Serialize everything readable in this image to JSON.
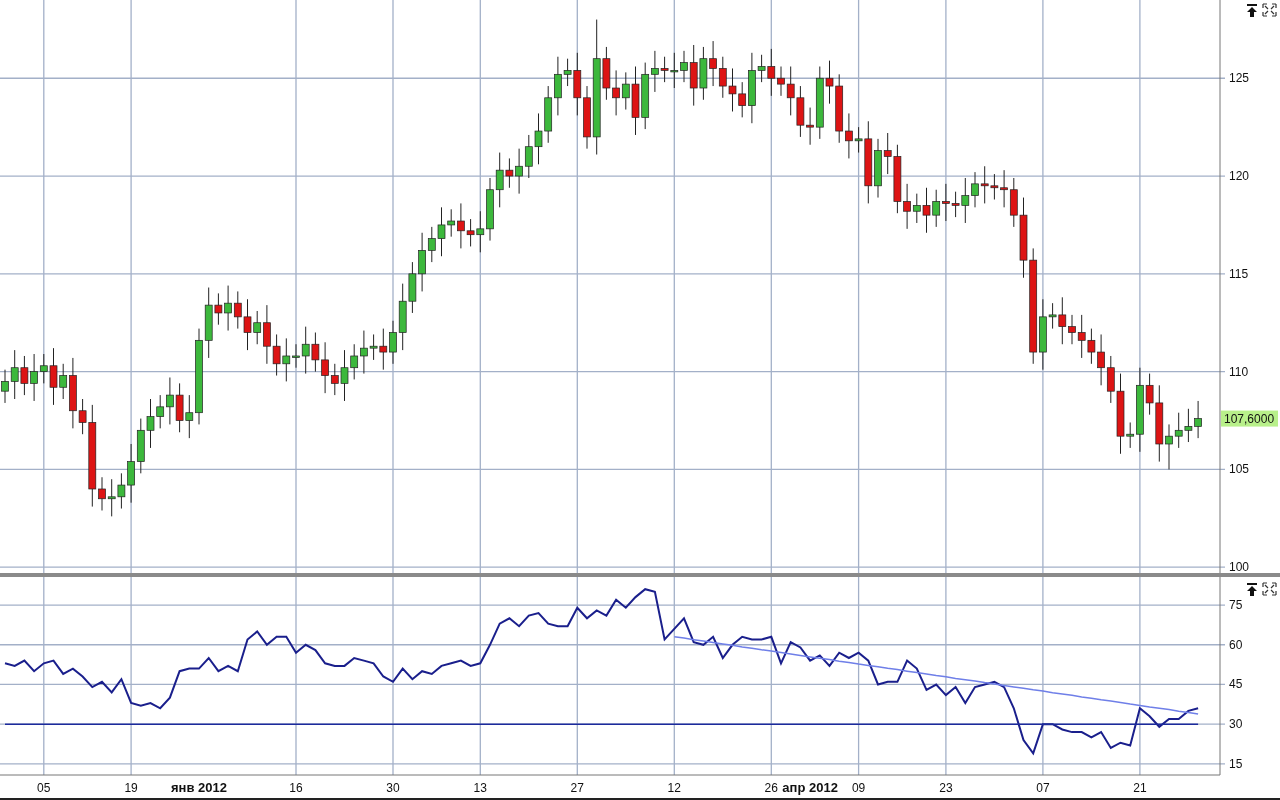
{
  "price_panel": {
    "last_price_tag": "107,6000",
    "chart_data": {
      "type": "candlestick",
      "grid": true,
      "ylim": [
        99.5,
        129
      ],
      "yticks": [
        100,
        105,
        110,
        115,
        120,
        125
      ],
      "ohlc": [
        [
          109.0,
          110.1,
          108.4,
          109.5
        ],
        [
          109.5,
          111.1,
          108.6,
          110.2
        ],
        [
          110.2,
          110.8,
          108.8,
          109.4
        ],
        [
          109.4,
          110.9,
          108.5,
          110.0
        ],
        [
          110.0,
          110.9,
          109.4,
          110.3
        ],
        [
          110.3,
          111.2,
          108.3,
          109.2
        ],
        [
          109.2,
          110.4,
          108.6,
          109.8
        ],
        [
          109.8,
          110.7,
          107.1,
          108.0
        ],
        [
          108.0,
          108.6,
          106.8,
          107.4
        ],
        [
          107.4,
          108.3,
          103.1,
          104.0
        ],
        [
          104.0,
          104.6,
          102.9,
          103.5
        ],
        [
          103.5,
          104.5,
          102.6,
          103.6
        ],
        [
          103.6,
          104.8,
          103.0,
          104.2
        ],
        [
          104.2,
          106.3,
          103.3,
          105.4
        ],
        [
          105.4,
          107.6,
          104.8,
          107.0
        ],
        [
          107.0,
          108.6,
          106.1,
          107.7
        ],
        [
          107.7,
          108.8,
          107.1,
          108.2
        ],
        [
          108.2,
          109.7,
          107.3,
          108.8
        ],
        [
          108.8,
          109.4,
          106.9,
          107.5
        ],
        [
          107.5,
          108.8,
          106.6,
          107.9
        ],
        [
          107.9,
          112.2,
          107.3,
          111.6
        ],
        [
          111.6,
          114.3,
          110.7,
          113.4
        ],
        [
          113.4,
          114.0,
          112.4,
          113.0
        ],
        [
          113.0,
          114.4,
          112.1,
          113.5
        ],
        [
          113.5,
          114.1,
          112.2,
          112.8
        ],
        [
          112.8,
          113.7,
          111.1,
          112.0
        ],
        [
          112.0,
          113.1,
          111.4,
          112.5
        ],
        [
          112.5,
          113.4,
          110.4,
          111.3
        ],
        [
          111.3,
          111.9,
          109.8,
          110.4
        ],
        [
          110.4,
          111.7,
          109.5,
          110.8
        ],
        [
          110.8,
          111.4,
          110.2,
          110.8
        ],
        [
          110.8,
          112.3,
          109.9,
          111.4
        ],
        [
          111.4,
          112.0,
          110.0,
          110.6
        ],
        [
          110.6,
          111.5,
          108.9,
          109.8
        ],
        [
          109.8,
          110.4,
          108.8,
          109.4
        ],
        [
          109.4,
          111.1,
          108.5,
          110.2
        ],
        [
          110.2,
          111.4,
          109.6,
          110.8
        ],
        [
          110.8,
          112.1,
          109.9,
          111.2
        ],
        [
          111.2,
          111.9,
          110.6,
          111.3
        ],
        [
          111.3,
          112.2,
          110.1,
          111.0
        ],
        [
          111.0,
          112.6,
          110.4,
          112.0
        ],
        [
          112.0,
          114.5,
          111.1,
          113.6
        ],
        [
          113.6,
          115.6,
          113.0,
          115.0
        ],
        [
          115.0,
          117.1,
          114.1,
          116.2
        ],
        [
          116.2,
          117.4,
          115.6,
          116.8
        ],
        [
          116.8,
          118.4,
          115.9,
          117.5
        ],
        [
          117.5,
          118.3,
          116.9,
          117.7
        ],
        [
          117.7,
          118.6,
          116.3,
          117.2
        ],
        [
          117.2,
          117.8,
          116.4,
          117.0
        ],
        [
          117.0,
          118.2,
          116.1,
          117.3
        ],
        [
          117.3,
          119.9,
          116.7,
          119.3
        ],
        [
          119.3,
          121.2,
          118.4,
          120.3
        ],
        [
          120.3,
          120.9,
          119.4,
          120.0
        ],
        [
          120.0,
          121.4,
          119.1,
          120.5
        ],
        [
          120.5,
          122.1,
          119.9,
          121.5
        ],
        [
          121.5,
          123.2,
          120.6,
          122.3
        ],
        [
          122.3,
          124.6,
          121.7,
          124.0
        ],
        [
          124.0,
          126.1,
          123.1,
          125.2
        ],
        [
          125.2,
          126.0,
          124.6,
          125.4
        ],
        [
          125.4,
          126.3,
          123.1,
          124.0
        ],
        [
          124.0,
          124.6,
          121.4,
          122.0
        ],
        [
          122.0,
          128.0,
          121.1,
          126.0
        ],
        [
          126.0,
          126.6,
          123.9,
          124.5
        ],
        [
          124.5,
          125.4,
          123.1,
          124.0
        ],
        [
          124.0,
          125.3,
          123.4,
          124.7
        ],
        [
          124.7,
          125.6,
          122.1,
          123.0
        ],
        [
          123.0,
          125.8,
          122.4,
          125.2
        ],
        [
          125.2,
          126.4,
          124.3,
          125.5
        ],
        [
          125.5,
          126.1,
          124.8,
          125.4
        ],
        [
          125.4,
          126.3,
          124.5,
          125.4
        ],
        [
          125.4,
          126.4,
          124.8,
          125.8
        ],
        [
          125.8,
          126.7,
          123.6,
          124.5
        ],
        [
          124.5,
          126.6,
          123.9,
          126.0
        ],
        [
          126.0,
          126.9,
          124.6,
          125.5
        ],
        [
          125.5,
          126.1,
          124.0,
          124.6
        ],
        [
          124.6,
          125.5,
          123.3,
          124.2
        ],
        [
          124.2,
          124.8,
          123.0,
          123.6
        ],
        [
          123.6,
          126.3,
          122.7,
          125.4
        ],
        [
          125.4,
          126.2,
          124.8,
          125.6
        ],
        [
          125.6,
          126.5,
          124.1,
          125.0
        ],
        [
          125.0,
          125.6,
          124.1,
          124.7
        ],
        [
          124.7,
          125.6,
          123.1,
          124.0
        ],
        [
          124.0,
          124.6,
          122.0,
          122.6
        ],
        [
          122.6,
          123.5,
          121.6,
          122.5
        ],
        [
          122.5,
          125.6,
          121.9,
          125.0
        ],
        [
          125.0,
          125.9,
          123.7,
          124.6
        ],
        [
          124.6,
          125.2,
          121.7,
          122.3
        ],
        [
          122.3,
          123.2,
          120.9,
          121.8
        ],
        [
          121.8,
          122.5,
          121.2,
          121.9
        ],
        [
          121.9,
          122.8,
          118.6,
          119.5
        ],
        [
          119.5,
          121.9,
          118.9,
          121.3
        ],
        [
          121.3,
          122.2,
          120.1,
          121.0
        ],
        [
          121.0,
          121.6,
          118.1,
          118.7
        ],
        [
          118.7,
          119.6,
          117.3,
          118.2
        ],
        [
          118.2,
          119.1,
          117.6,
          118.5
        ],
        [
          118.5,
          119.4,
          117.1,
          118.0
        ],
        [
          118.0,
          119.3,
          117.4,
          118.7
        ],
        [
          118.7,
          119.6,
          117.7,
          118.6
        ],
        [
          118.6,
          119.2,
          117.9,
          118.5
        ],
        [
          118.5,
          119.9,
          117.6,
          119.0
        ],
        [
          119.0,
          120.2,
          118.4,
          119.6
        ],
        [
          119.6,
          120.5,
          118.6,
          119.5
        ],
        [
          119.5,
          120.1,
          118.8,
          119.4
        ],
        [
          119.4,
          120.3,
          118.4,
          119.3
        ],
        [
          119.3,
          119.9,
          117.4,
          118.0
        ],
        [
          118.0,
          118.9,
          114.8,
          115.7
        ],
        [
          115.7,
          116.3,
          110.4,
          111.0
        ],
        [
          111.0,
          113.7,
          110.1,
          112.8
        ],
        [
          112.8,
          113.5,
          112.2,
          112.9
        ],
        [
          112.9,
          113.8,
          111.4,
          112.3
        ],
        [
          112.3,
          112.9,
          111.4,
          112.0
        ],
        [
          112.0,
          112.9,
          110.7,
          111.6
        ],
        [
          111.6,
          112.2,
          110.4,
          111.0
        ],
        [
          111.0,
          111.9,
          109.3,
          110.2
        ],
        [
          110.2,
          110.8,
          108.4,
          109.0
        ],
        [
          109.0,
          109.9,
          105.8,
          106.7
        ],
        [
          106.7,
          107.4,
          106.1,
          106.8
        ],
        [
          106.8,
          110.2,
          105.9,
          109.3
        ],
        [
          109.3,
          109.9,
          107.8,
          108.4
        ],
        [
          108.4,
          109.3,
          105.4,
          106.3
        ],
        [
          106.3,
          107.3,
          105.0,
          106.7
        ],
        [
          106.7,
          107.9,
          106.1,
          107.0
        ],
        [
          107.0,
          108.1,
          106.4,
          107.2
        ],
        [
          107.2,
          108.5,
          106.6,
          107.6
        ]
      ]
    }
  },
  "indicator_panel": {
    "chart_data": {
      "type": "line",
      "grid": true,
      "ylim": [
        10.8,
        85.6
      ],
      "yticks": [
        15,
        30,
        45,
        60,
        75
      ],
      "categories": [
        null,
        null,
        null,
        null,
        "05",
        null,
        null,
        null,
        null,
        null,
        null,
        null,
        null,
        "19",
        null,
        null,
        null,
        null,
        null,
        null,
        "янв 2012",
        null,
        null,
        null,
        null,
        null,
        null,
        null,
        null,
        null,
        "16",
        null,
        null,
        null,
        null,
        null,
        null,
        null,
        null,
        null,
        "30",
        null,
        null,
        null,
        null,
        null,
        null,
        null,
        null,
        "13",
        null,
        null,
        null,
        null,
        null,
        null,
        null,
        null,
        null,
        "27",
        null,
        null,
        null,
        null,
        null,
        null,
        null,
        null,
        null,
        "12",
        null,
        null,
        null,
        null,
        null,
        null,
        null,
        null,
        null,
        "26",
        null,
        null,
        null,
        "апр 2012",
        null,
        null,
        null,
        null,
        "09",
        null,
        null,
        null,
        null,
        null,
        null,
        null,
        null,
        "23",
        null,
        null,
        null,
        null,
        null,
        null,
        null,
        null,
        null,
        "07",
        null,
        null,
        null,
        null,
        null,
        null,
        null,
        null,
        null,
        "21",
        null,
        null,
        null,
        null,
        null,
        null
      ],
      "series": [
        {
          "color": "#1a1f8c",
          "values": [
            53,
            52,
            54,
            50,
            53,
            54,
            49,
            51,
            48,
            44,
            46,
            42,
            47,
            38,
            37,
            38,
            36,
            40,
            50,
            51,
            51,
            55,
            50,
            52,
            50,
            62,
            65,
            60,
            63,
            63,
            57,
            60,
            58,
            53,
            52,
            52,
            55,
            54,
            53,
            48,
            46,
            51,
            47,
            50,
            49,
            52,
            53,
            54,
            52,
            53,
            60,
            68,
            70,
            67,
            71,
            72,
            68,
            67,
            67,
            74,
            70,
            73,
            71,
            77,
            74,
            78,
            81,
            80,
            62,
            66,
            70,
            61,
            60,
            63,
            55,
            60,
            63,
            62,
            62,
            63,
            53,
            61,
            59,
            54,
            56,
            52,
            57,
            55,
            57,
            54,
            45,
            46,
            46,
            54,
            51,
            43,
            45,
            41,
            44,
            38,
            44,
            45,
            46,
            44,
            36,
            24,
            19,
            30,
            30,
            28,
            27,
            27,
            25,
            27,
            21,
            23,
            22,
            36,
            33,
            29,
            32,
            32,
            35,
            36
          ]
        },
        {
          "color": "#1c2a9c",
          "values": [
            30,
            30,
            30,
            30,
            30,
            30,
            30,
            30,
            30,
            30,
            30,
            30,
            30,
            30,
            30,
            30,
            30,
            30,
            30,
            30,
            30,
            30,
            30,
            30,
            30,
            30,
            30,
            30,
            30,
            30,
            30,
            30,
            30,
            30,
            30,
            30,
            30,
            30,
            30,
            30,
            30,
            30,
            30,
            30,
            30,
            30,
            30,
            30,
            30,
            30,
            30,
            30,
            30,
            30,
            30,
            30,
            30,
            30,
            30,
            30,
            30,
            30,
            30,
            30,
            30,
            30,
            30,
            30,
            30,
            30,
            30,
            30,
            30,
            30,
            30,
            30,
            30,
            30,
            30,
            30,
            30,
            30,
            30,
            30,
            30,
            30,
            30,
            30,
            30,
            30,
            30,
            30,
            30,
            30,
            30,
            30,
            30,
            30,
            30,
            30,
            30,
            30,
            30,
            30,
            30,
            30,
            30,
            30,
            30,
            30,
            30,
            30,
            30,
            30,
            30,
            30,
            30,
            30,
            30,
            30,
            30,
            30,
            30,
            30
          ]
        },
        {
          "color": "#6f7fe8",
          "values": [
            null,
            null,
            null,
            null,
            null,
            null,
            null,
            null,
            null,
            null,
            null,
            null,
            null,
            null,
            null,
            null,
            null,
            null,
            null,
            null,
            null,
            null,
            null,
            null,
            null,
            null,
            null,
            null,
            null,
            null,
            null,
            null,
            null,
            null,
            null,
            null,
            null,
            null,
            null,
            null,
            null,
            null,
            null,
            null,
            null,
            null,
            null,
            null,
            null,
            null,
            null,
            null,
            null,
            null,
            null,
            null,
            null,
            null,
            null,
            null,
            null,
            null,
            null,
            null,
            null,
            null,
            null,
            null,
            null,
            63.0,
            62.5,
            61.9,
            61.4,
            60.8,
            60.3,
            59.8,
            59.2,
            58.7,
            58.1,
            57.6,
            57.1,
            56.5,
            56.0,
            55.4,
            54.9,
            54.4,
            53.8,
            53.3,
            52.7,
            52.2,
            51.7,
            51.1,
            50.6,
            50.0,
            49.5,
            49.0,
            48.4,
            47.9,
            47.3,
            46.8,
            46.3,
            45.7,
            45.2,
            44.6,
            44.1,
            43.6,
            43.0,
            42.5,
            41.9,
            41.4,
            40.9,
            40.3,
            39.8,
            39.2,
            38.7,
            38.2,
            37.6,
            37.1,
            36.5,
            36.0,
            35.5,
            34.9,
            34.4,
            33.8
          ]
        }
      ]
    }
  }
}
